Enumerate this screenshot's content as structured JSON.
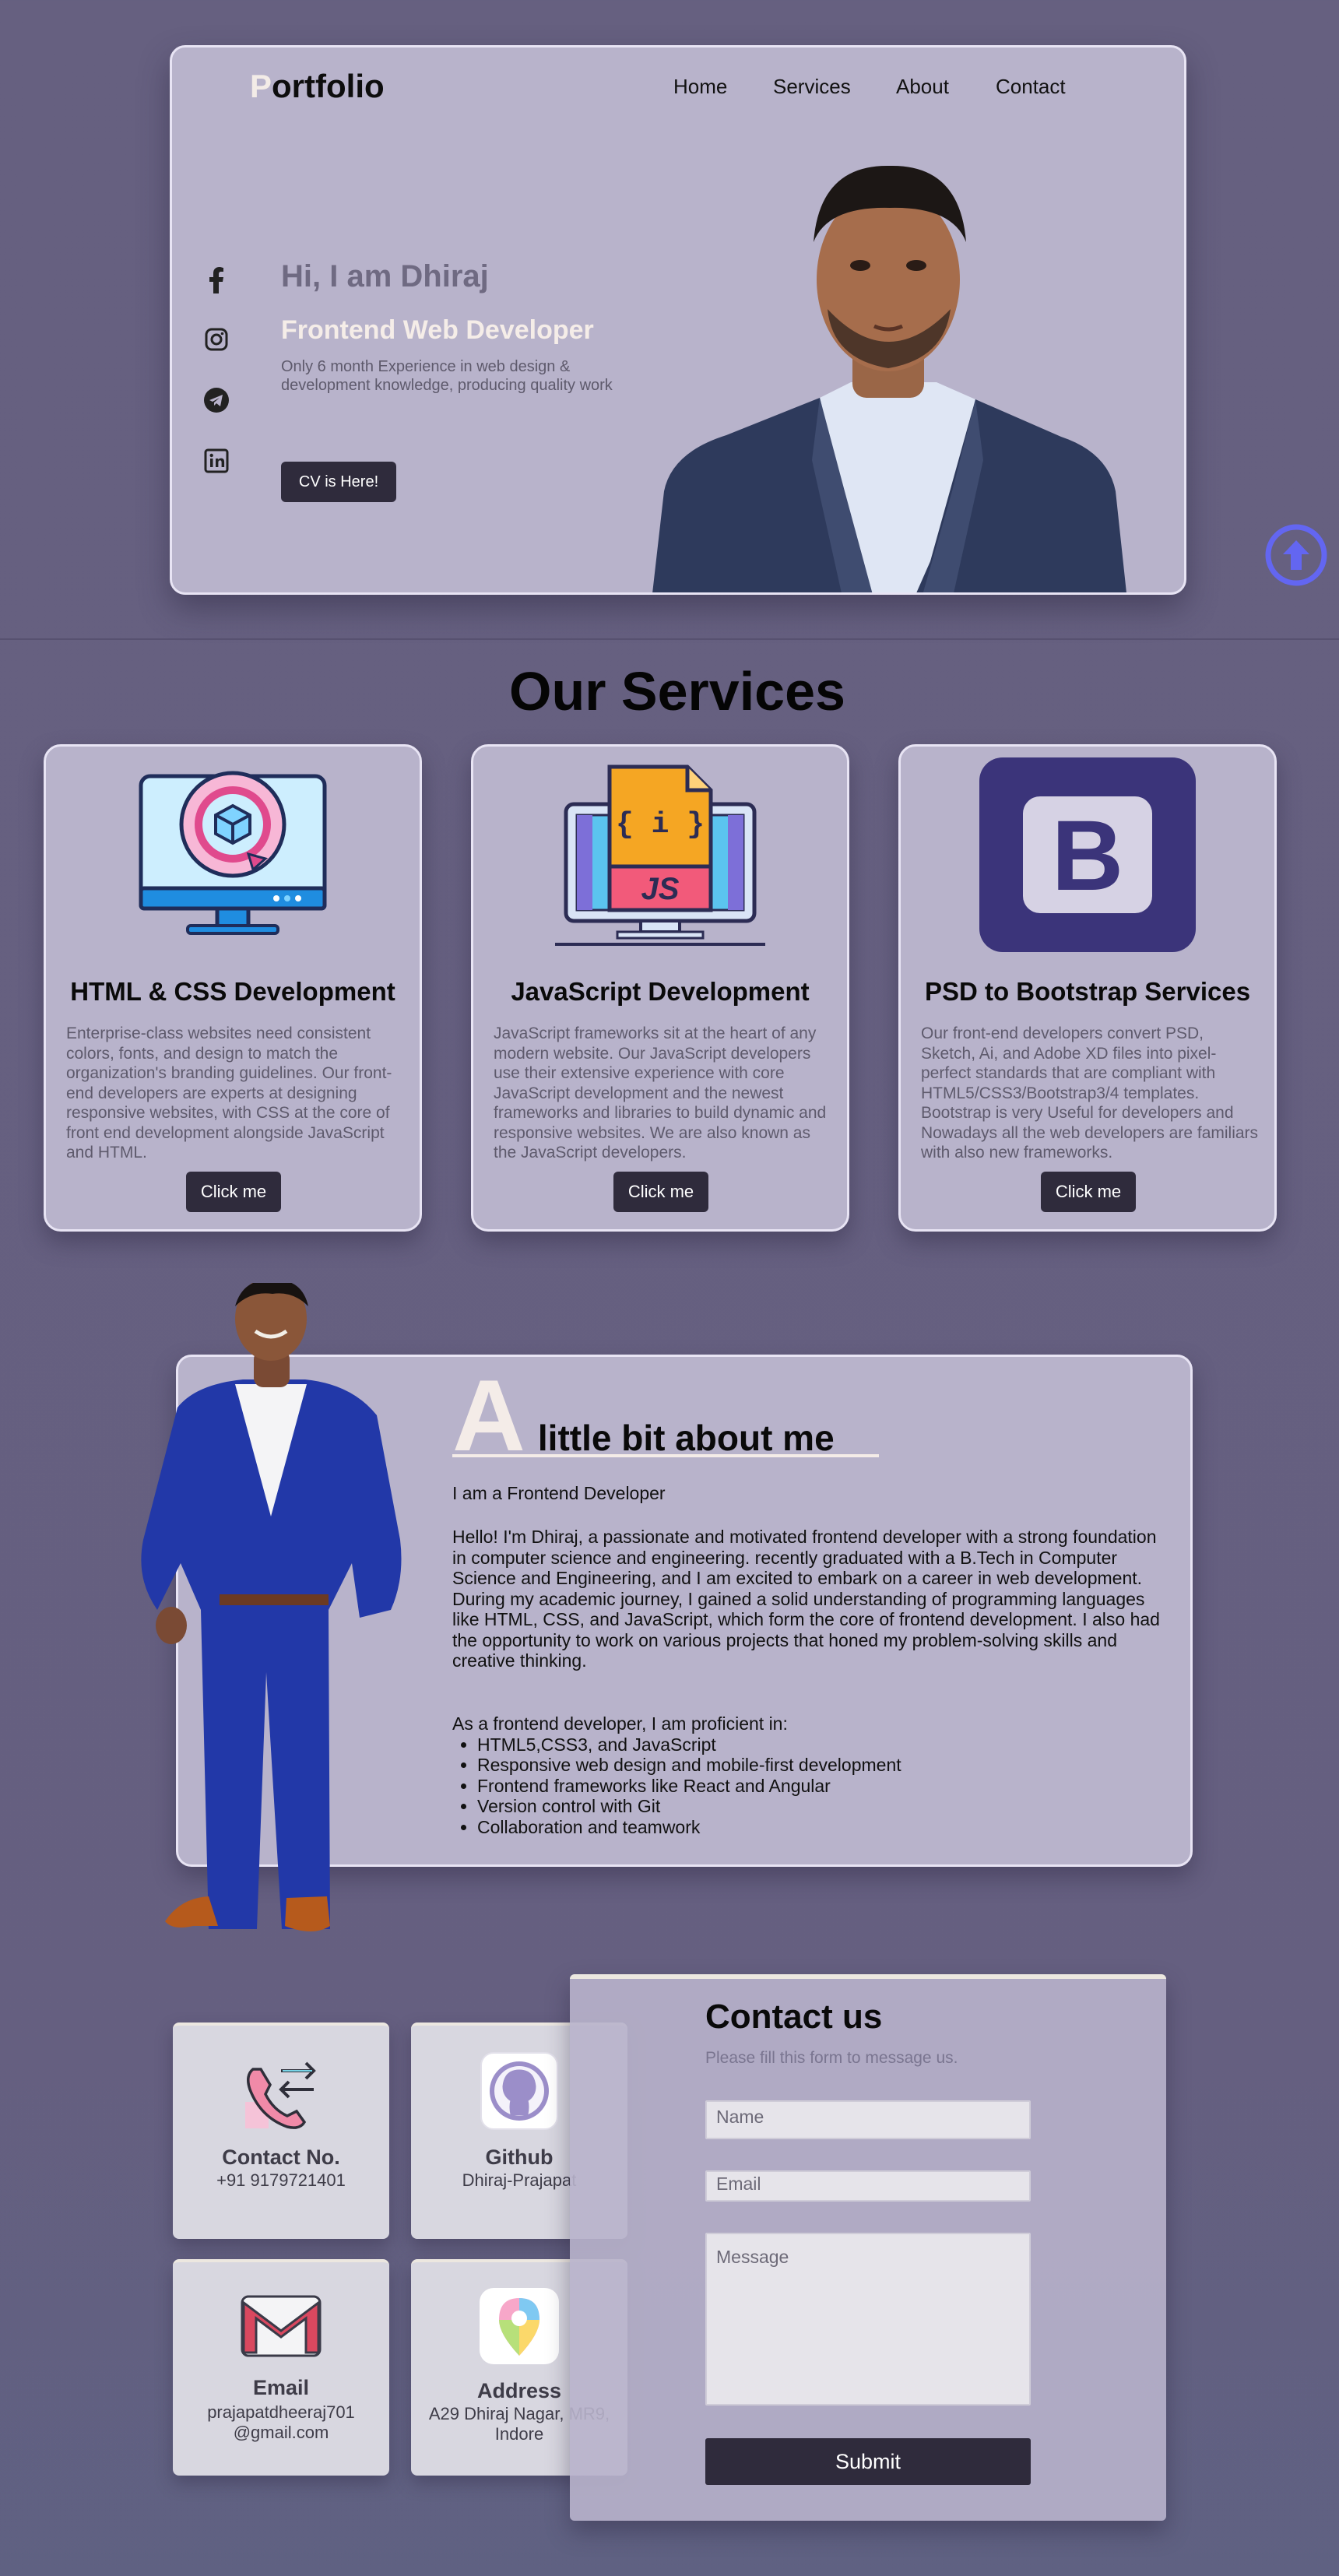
{
  "header": {
    "logo_first": "P",
    "logo_rest": "ortfolio",
    "nav": [
      "Home",
      "Services",
      "About",
      "Contact"
    ]
  },
  "hero": {
    "greeting": "Hi, I am Dhiraj",
    "role": "Frontend Web Developer",
    "description": "Only 6 month Experience in web design & development knowledge, producing quality work",
    "cv_button": "CV is Here!",
    "social_icons": [
      "facebook-icon",
      "instagram-icon",
      "telegram-icon",
      "linkedin-icon"
    ]
  },
  "services": {
    "title": "Our Services",
    "cards": [
      {
        "title": "HTML & CSS Development",
        "text": "Enterprise-class websites need consistent colors, fonts, and design to match the organization's branding guidelines. Our front-end developers are experts at designing responsive websites, with CSS at the core of front end development alongside JavaScript and HTML.",
        "button": "Click me",
        "icon": "html-css-monitor-icon"
      },
      {
        "title": "JavaScript Development",
        "text": "JavaScript frameworks sit at the heart of any modern website. Our JavaScript developers use their extensive experience with core JavaScript development and the newest frameworks and libraries to build dynamic and responsive websites. We are also known as the JavaScript developers.",
        "button": "Click me",
        "icon": "javascript-file-icon",
        "icon_text": "{ i }",
        "icon_label": "JS"
      },
      {
        "title": "PSD to Bootstrap Services",
        "text": "Our front-end developers convert PSD, Sketch, Ai, and Adobe XD files into pixel-perfect standards that are compliant with HTML5/CSS3/Bootstrap3/4 templates. Bootstrap is very Useful for developers and Nowadays all the web developers are familiars with also new frameworks.",
        "button": "Click me",
        "icon": "bootstrap-logo-icon",
        "icon_label": "B"
      }
    ]
  },
  "about": {
    "big_letter": "A",
    "heading_rest": "little bit about me",
    "subtitle": "I am a Frontend Developer",
    "paragraph1": "Hello! I'm Dhiraj, a passionate and motivated frontend developer with a strong foundation in computer science and engineering. recently graduated with a B.Tech in Computer Science and Engineering, and I am excited to embark on a career in web development.",
    "paragraph2": "During my academic journey, I gained a solid understanding of programming languages like HTML, CSS, and JavaScript, which form the core of frontend development. I also had the opportunity to work on various projects that honed my problem-solving skills and creative thinking.",
    "list_intro": "As a frontend developer, I am proficient in:",
    "skills": [
      "HTML5,CSS3, and JavaScript",
      "Responsive web design and mobile-first development",
      "Frontend frameworks like React and Angular",
      "Version control with Git",
      "Collaboration and teamwork"
    ]
  },
  "contact_cards": [
    {
      "title": "Contact No.",
      "lines": [
        "+91 9179721401"
      ],
      "icon": "phone-transfer-icon"
    },
    {
      "title": "Github",
      "lines": [
        "Dhiraj-Prajapat"
      ],
      "icon": "github-icon"
    },
    {
      "title": "Email",
      "lines": [
        "prajapatdheeraj701",
        "@gmail.com"
      ],
      "icon": "gmail-icon"
    },
    {
      "title": "Address",
      "lines": [
        "A29 Dhiraj Nagar, MR9,",
        "Indore"
      ],
      "icon": "map-pin-icon"
    }
  ],
  "contact_form": {
    "title": "Contact us",
    "subtitle": "Please fill this form to message us.",
    "name_placeholder": "Name",
    "email_placeholder": "Email",
    "message_placeholder": "Message",
    "submit": "Submit"
  },
  "colors": {
    "page_bg": "#666080",
    "panel": "#b8b3cb",
    "button": "#2f2b3c",
    "accent_cream": "#f4ece8",
    "scroll_icon": "#6366f1"
  }
}
